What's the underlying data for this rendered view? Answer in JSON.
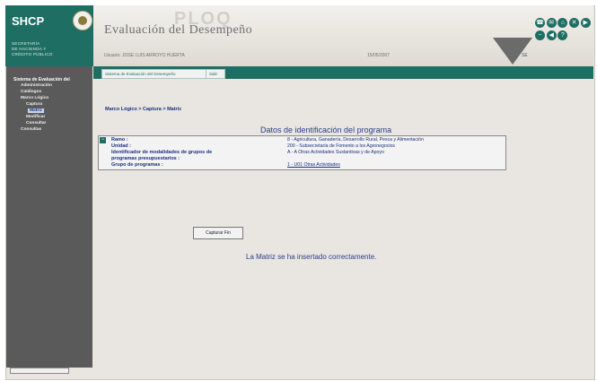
{
  "brand": {
    "logo": "SHCP",
    "subtitle": [
      "SECRETARÍA",
      "DE HACIENDA Y",
      "CRÉDITO PÚBLICO"
    ]
  },
  "header": {
    "title": "Evaluación del Desempeño",
    "watermark": "PLOQ",
    "user": "Usuario: JOSE LUIS ARROYO HUERTA",
    "date": "15/05/2007",
    "tail": "SE"
  },
  "icons": [
    "phone-icon",
    "mail-icon",
    "home-icon",
    "close-icon",
    "forward-icon",
    "minus-icon",
    "back-icon",
    "help-icon"
  ],
  "tabs": [
    "Sistema de Evaluación del Desempeño",
    "Salir"
  ],
  "sidebar": {
    "heading": "Sistema de Evaluación del",
    "items": [
      "Administración",
      "Catálogos",
      "Marco Lógico",
      "Captura",
      "Matriz",
      "Modificar",
      "Consultar",
      "Consultas"
    ],
    "selected": "Matriz"
  },
  "breadcrumb": "Marco Lógico > Captura > Matriz",
  "program": {
    "section_title": "Datos de identificación del programa",
    "fields": [
      {
        "label": "Ramo :",
        "value": "8 - Agricultura, Ganadería, Desarrollo Rural, Pesca y Alimentación"
      },
      {
        "label": "Unidad :",
        "value": "200 - Subsecretaría de Fomento a los Agronegocios"
      },
      {
        "label": "Identificador de modalidades de grupos de",
        "value": "A - A Otras Actividades Sustantivas y de Apoyo"
      },
      {
        "label": "programas presupuestarios :",
        "value": ""
      },
      {
        "label": "Grupo de programas :",
        "value": "1 - U01 Otras Actividades"
      }
    ]
  },
  "buttons": {
    "capture": "Capturar Fin"
  },
  "message": "La Matriz se ha insertado correctamente."
}
